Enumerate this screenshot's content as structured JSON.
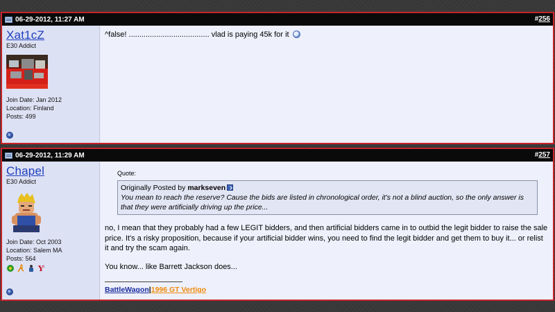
{
  "posts": [
    {
      "date": "06-29-2012, 11:27 AM",
      "hash": "#",
      "number": "256",
      "username": "Xat1cZ",
      "usertitle": "E30 Addict",
      "join_date": "Join Date: Jan 2012",
      "location": "Location: Finland",
      "posts": "Posts: 499",
      "message": "^false! ...................................... vlad is paying 45k for it"
    },
    {
      "date": "06-29-2012, 11:29 AM",
      "hash": "#",
      "number": "257",
      "username": "Chapel",
      "usertitle": "E30 Addict",
      "join_date": "Join Date: Oct 2003",
      "location": "Location: Salem MA",
      "posts": "Posts: 564",
      "quote_label": "Quote:",
      "quote_by_prefix": "Originally Posted by",
      "quote_author": "markseven",
      "quote_text": "You mean to reach the reserve? Cause the bids are listed in chronological order, it's not a blind auction, so the only answer is that they were artificially driving up the price...",
      "reply_p1": "no, I mean that they probably had a few LEGIT bidders, and then artificial bidders came in to outbid the legit bidder to raise the sale price. It's a risky proposition, because if your artificial bidder wins, you need to find the legit bidder and get them to buy it... or relist it and try the scam again.",
      "reply_p2": "You know... like Barrett Jackson does...",
      "sig_link1": "BattleWagon",
      "sig_sep": "|",
      "sig_link2": "1996 GT Vertigo"
    }
  ],
  "colors": {
    "post_border": "#c8232b",
    "username": "#1e3fbd",
    "sig_link1": "#1a2d9e",
    "sig_link2": "#f08a0a"
  },
  "icons": [
    "post-doc-icon",
    "smiley-icon",
    "view-post-icon",
    "online-status-icon",
    "achievement-badge-icon"
  ]
}
